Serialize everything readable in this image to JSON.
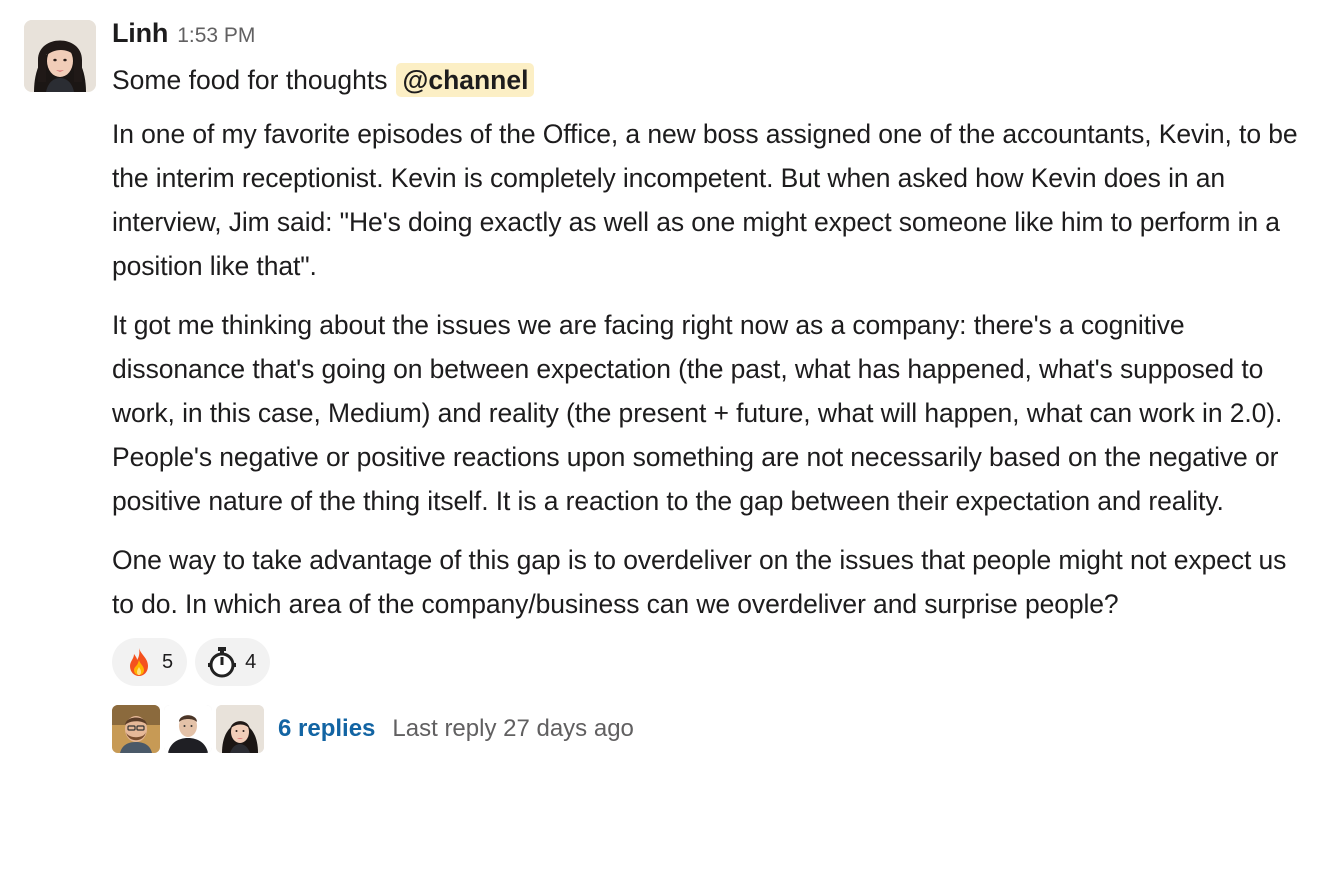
{
  "message": {
    "author": "Linh",
    "timestamp": "1:53 PM",
    "intro": "Some food for thoughts",
    "mention": "@channel",
    "paragraphs": [
      "In one of my favorite episodes of the Office, a new boss assigned one of the accountants, Kevin, to be the interim receptionist. Kevin is completely incompetent. But when asked how Kevin does in an interview, Jim said: \"He's doing exactly as well as one might expect someone like him to perform in a position like that\".",
      "It got me thinking about the issues we are facing right now as a company: there's a cognitive dissonance that's going on between expectation (the past, what has happened, what's supposed to work, in this case, Medium) and reality (the present + future, what will happen, what can work in 2.0). People's negative or positive reactions upon something are not necessarily based on the negative or positive nature of the thing itself. It is a reaction to the gap between their expectation and reality.",
      "One way to take advantage of this gap is to overdeliver on the issues that people might not expect us to do. In which area of the company/business can we overdeliver and surprise people?"
    ],
    "reactions": [
      {
        "emoji": "fire-icon",
        "count": "5"
      },
      {
        "emoji": "stopwatch-icon",
        "count": "4"
      }
    ],
    "thread": {
      "replies": "6 replies",
      "last_reply": "Last reply 27 days ago"
    }
  },
  "colors": {
    "link": "#1264a3",
    "mention_bg": "#fcefc5",
    "reaction_bg": "#f2f2f2",
    "muted_text": "#616061"
  }
}
